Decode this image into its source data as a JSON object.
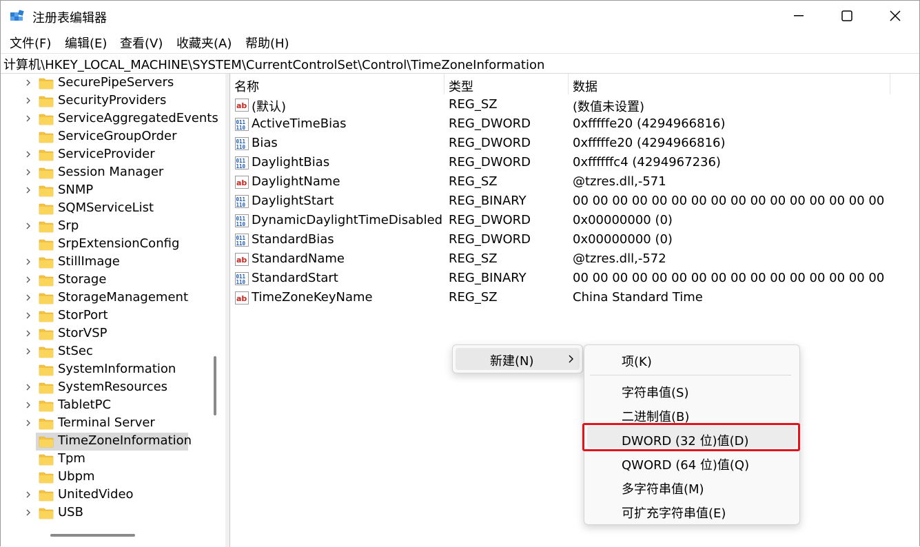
{
  "window": {
    "title": "注册表编辑器",
    "minimize_icon": "minimize-icon",
    "maximize_icon": "maximize-icon",
    "close_icon": "close-icon"
  },
  "menubar": {
    "items": [
      "文件(F)",
      "编辑(E)",
      "查看(V)",
      "收藏夹(A)",
      "帮助(H)"
    ]
  },
  "address": {
    "path": "计算机\\HKEY_LOCAL_MACHINE\\SYSTEM\\CurrentControlSet\\Control\\TimeZoneInformation"
  },
  "tree": {
    "items": [
      {
        "label": "SecurePipeServers",
        "expandable": true
      },
      {
        "label": "SecurityProviders",
        "expandable": true
      },
      {
        "label": "ServiceAggregatedEvents",
        "expandable": true
      },
      {
        "label": "ServiceGroupOrder",
        "expandable": false
      },
      {
        "label": "ServiceProvider",
        "expandable": true
      },
      {
        "label": "Session Manager",
        "expandable": true
      },
      {
        "label": "SNMP",
        "expandable": true
      },
      {
        "label": "SQMServiceList",
        "expandable": false
      },
      {
        "label": "Srp",
        "expandable": true
      },
      {
        "label": "SrpExtensionConfig",
        "expandable": false
      },
      {
        "label": "StillImage",
        "expandable": true
      },
      {
        "label": "Storage",
        "expandable": true
      },
      {
        "label": "StorageManagement",
        "expandable": true
      },
      {
        "label": "StorPort",
        "expandable": true
      },
      {
        "label": "StorVSP",
        "expandable": true
      },
      {
        "label": "StSec",
        "expandable": true
      },
      {
        "label": "SystemInformation",
        "expandable": false
      },
      {
        "label": "SystemResources",
        "expandable": true
      },
      {
        "label": "TabletPC",
        "expandable": true
      },
      {
        "label": "Terminal Server",
        "expandable": true
      },
      {
        "label": "TimeZoneInformation",
        "expandable": false,
        "selected": true
      },
      {
        "label": "Tpm",
        "expandable": false
      },
      {
        "label": "Ubpm",
        "expandable": false
      },
      {
        "label": "UnitedVideo",
        "expandable": true
      },
      {
        "label": "USB",
        "expandable": true
      }
    ]
  },
  "list": {
    "headers": {
      "name": "名称",
      "type": "类型",
      "data": "数据"
    },
    "rows": [
      {
        "icon": "string-value-icon",
        "name": "(默认)",
        "type": "REG_SZ",
        "data": "(数值未设置)"
      },
      {
        "icon": "binary-value-icon",
        "name": "ActiveTimeBias",
        "type": "REG_DWORD",
        "data": "0xfffffe20 (4294966816)"
      },
      {
        "icon": "binary-value-icon",
        "name": "Bias",
        "type": "REG_DWORD",
        "data": "0xfffffe20 (4294966816)"
      },
      {
        "icon": "binary-value-icon",
        "name": "DaylightBias",
        "type": "REG_DWORD",
        "data": "0xffffffc4 (4294967236)"
      },
      {
        "icon": "string-value-icon",
        "name": "DaylightName",
        "type": "REG_SZ",
        "data": "@tzres.dll,-571"
      },
      {
        "icon": "binary-value-icon",
        "name": "DaylightStart",
        "type": "REG_BINARY",
        "data": "00 00 00 00 00 00 00 00 00 00 00 00 00 00 00 00"
      },
      {
        "icon": "binary-value-icon",
        "name": "DynamicDaylightTimeDisabled",
        "type": "REG_DWORD",
        "data": "0x00000000 (0)"
      },
      {
        "icon": "binary-value-icon",
        "name": "StandardBias",
        "type": "REG_DWORD",
        "data": "0x00000000 (0)"
      },
      {
        "icon": "string-value-icon",
        "name": "StandardName",
        "type": "REG_SZ",
        "data": "@tzres.dll,-572"
      },
      {
        "icon": "binary-value-icon",
        "name": "StandardStart",
        "type": "REG_BINARY",
        "data": "00 00 00 00 00 00 00 00 00 00 00 00 00 00 00 00"
      },
      {
        "icon": "string-value-icon",
        "name": "TimeZoneKeyName",
        "type": "REG_SZ",
        "data": "China Standard Time"
      }
    ]
  },
  "context_menu": {
    "new_label": "新建(N)",
    "submenu": {
      "key": "项(K)",
      "string": "字符串值(S)",
      "binary": "二进制值(B)",
      "dword": "DWORD (32 位)值(D)",
      "qword": "QWORD (64 位)值(Q)",
      "multi_string": "多字符串值(M)",
      "expandable_string": "可扩充字符串值(E)"
    }
  },
  "colors": {
    "highlight_border": "#e2141b",
    "folder": "#f5c342",
    "selection": "#d9d9d9"
  }
}
